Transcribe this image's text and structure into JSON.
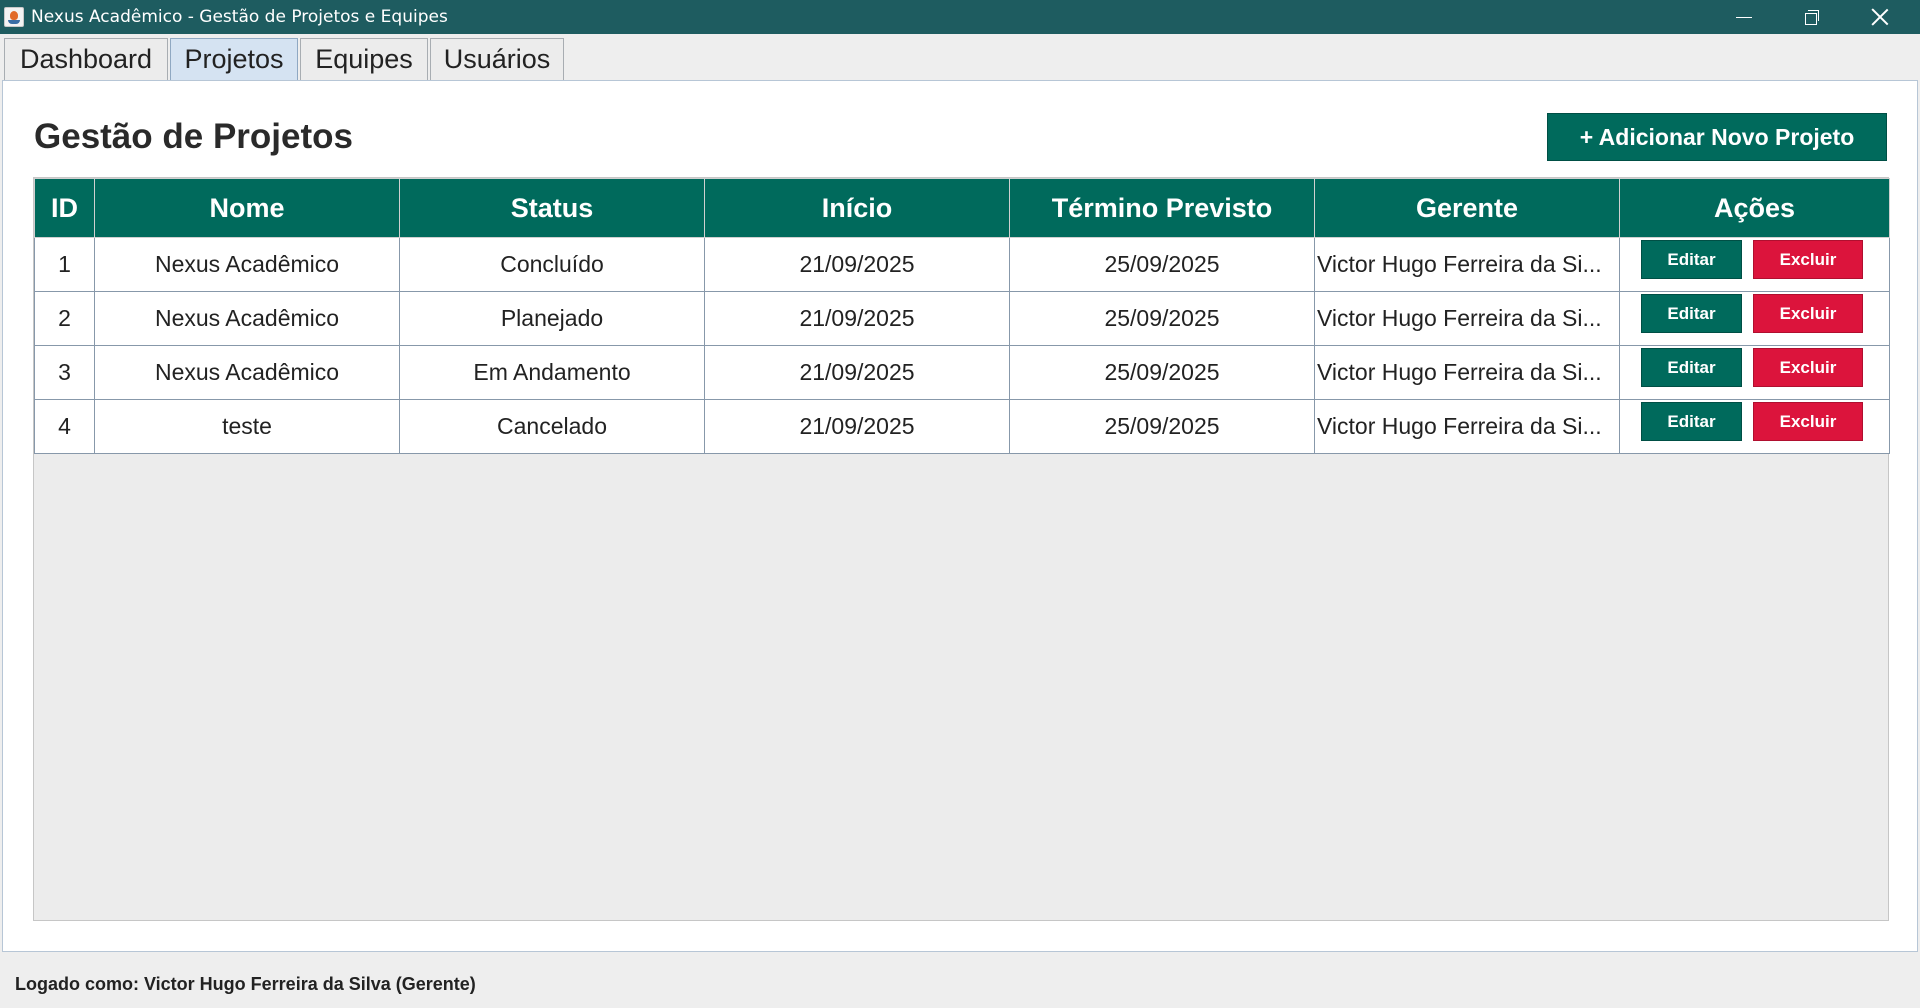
{
  "window": {
    "title": "Nexus Acadêmico - Gestão de Projetos e Equipes"
  },
  "tabs": [
    {
      "label": "Dashboard",
      "active": false
    },
    {
      "label": "Projetos",
      "active": true
    },
    {
      "label": "Equipes",
      "active": false
    },
    {
      "label": "Usuários",
      "active": false
    }
  ],
  "page": {
    "title": "Gestão de Projetos",
    "add_button_label": "+ Adicionar Novo Projeto"
  },
  "table": {
    "columns": [
      "ID",
      "Nome",
      "Status",
      "Início",
      "Término Previsto",
      "Gerente",
      "Ações"
    ],
    "edit_label": "Editar",
    "delete_label": "Excluir",
    "rows": [
      {
        "id": "1",
        "nome": "Nexus Acadêmico",
        "status": "Concluído",
        "inicio": "21/09/2025",
        "termino": "25/09/2025",
        "gerente": "Victor Hugo Ferreira da Si..."
      },
      {
        "id": "2",
        "nome": "Nexus Acadêmico",
        "status": "Planejado",
        "inicio": "21/09/2025",
        "termino": "25/09/2025",
        "gerente": "Victor Hugo Ferreira da Si..."
      },
      {
        "id": "3",
        "nome": "Nexus Acadêmico",
        "status": "Em Andamento",
        "inicio": "21/09/2025",
        "termino": "25/09/2025",
        "gerente": "Victor Hugo Ferreira da Si..."
      },
      {
        "id": "4",
        "nome": "teste",
        "status": "Cancelado",
        "inicio": "21/09/2025",
        "termino": "25/09/2025",
        "gerente": "Victor Hugo Ferreira da Si..."
      }
    ]
  },
  "status_bar": {
    "text": "Logado como: Victor Hugo Ferreira da Silva (Gerente)"
  },
  "colors": {
    "title_bar": "#1e5c60",
    "primary": "#006a5c",
    "danger": "#dc143c",
    "active_tab": "#d5e3f2"
  }
}
